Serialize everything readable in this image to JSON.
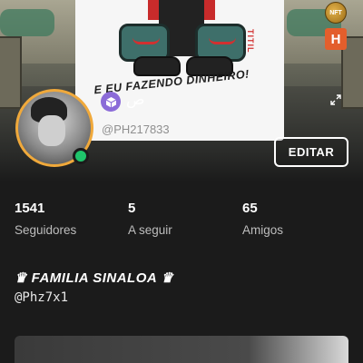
{
  "banner": {
    "caption": "E EU FAZENDO DINHEIRO!",
    "side_text": "TITIL",
    "nft_label": "NFT",
    "h_label": "H"
  },
  "profile": {
    "arabic_name": "ص",
    "username": "@PH217833",
    "edit_label": "EDITAR",
    "online": true
  },
  "stats": [
    {
      "value": "1541",
      "label": "Seguidores"
    },
    {
      "value": "5",
      "label": "A seguir"
    },
    {
      "value": "65",
      "label": "Amigos"
    }
  ],
  "bio": {
    "display_name": "♛ FAMILIA SINALOA ♛",
    "handle": "@Phz7x1"
  },
  "colors": {
    "background": "#1b1b1b",
    "avatar_ring": "#f0a93b",
    "online": "#1fc46b",
    "badge": "#8b6bd8"
  }
}
